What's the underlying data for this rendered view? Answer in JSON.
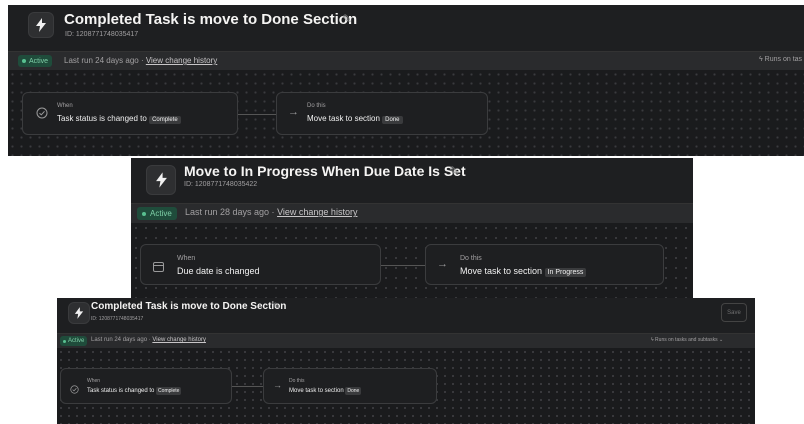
{
  "screens": [
    {
      "title": "Completed Task is move to Done Section",
      "id_text": "ID: 1208771748035417",
      "status": "Active",
      "last_run": "Last run 24 days ago · ",
      "history_link": "View change history",
      "runs_on": "Runs on tas",
      "when_label": "When",
      "trigger_text": "Task status is changed to",
      "trigger_chip": "Complete",
      "do_label": "Do this",
      "action_text": "Move task to section",
      "action_chip": "Done"
    },
    {
      "title": "Move to In Progress When Due Date Is Set",
      "id_text": "ID: 1208771748035422",
      "status": "Active",
      "last_run": "Last run 28 days ago · ",
      "history_link": "View change history",
      "when_label": "When",
      "trigger_text": "Due date is changed",
      "do_label": "Do this",
      "action_text": "Move task to section",
      "action_chip": "In Progress"
    },
    {
      "title": "Completed Task is move to Done Section",
      "id_text": "ID: 1208771748035417",
      "status": "Active",
      "last_run": "Last run 24 days ago · ",
      "history_link": "View change history",
      "runs_on": "Runs on tasks and subtasks",
      "save_label": "Save",
      "when_label": "When",
      "trigger_text": "Task status is changed to",
      "trigger_chip": "Complete",
      "do_label": "Do this",
      "action_text": "Move task to section",
      "action_chip": "Done"
    }
  ],
  "icons": {
    "bolt": "lightning-bolt-icon",
    "edit": "pencil-icon",
    "trigger_status": "check-circle-icon",
    "trigger_date": "calendar-icon",
    "action": "arrow-right-icon",
    "runs": "lightning-outline-icon"
  },
  "colors": {
    "panel_bg": "#1e1f21",
    "canvas_bg": "#1a1b1d",
    "active_badge_bg": "#1f4c3b",
    "active_badge_text": "#7fd0a8"
  }
}
